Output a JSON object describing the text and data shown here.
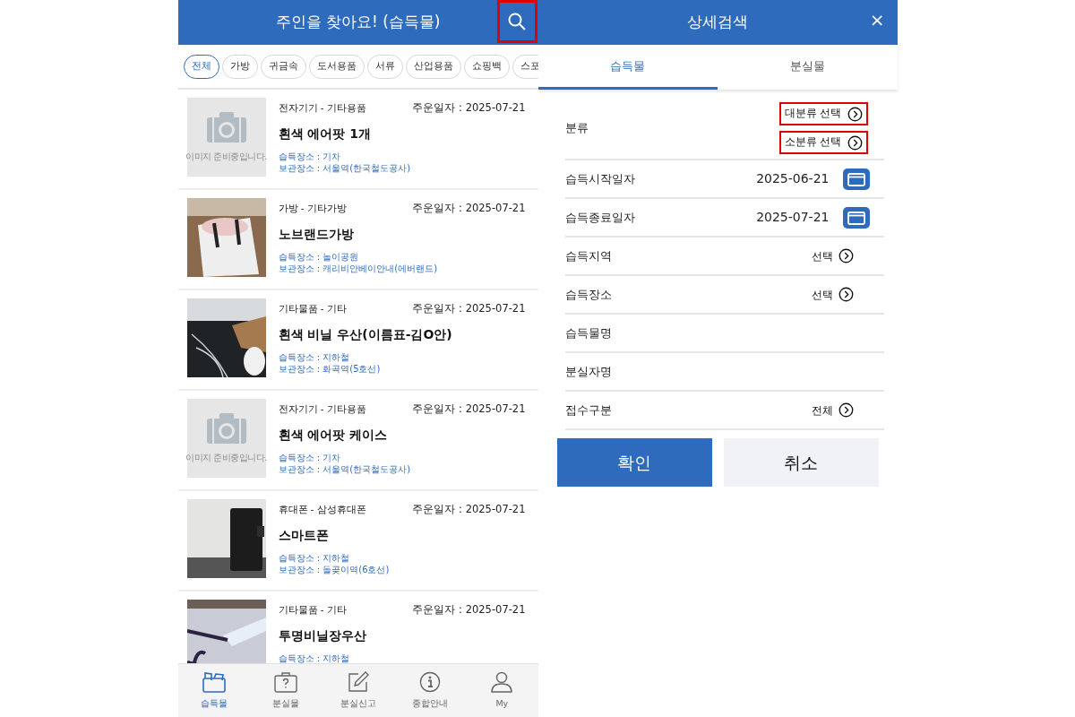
{
  "list_panel": {
    "title": "주인을 찾아요! (습득물)",
    "search_highlighted": true,
    "chips": [
      {
        "label": "전체",
        "selected": true
      },
      {
        "label": "가방",
        "selected": false
      },
      {
        "label": "귀금속",
        "selected": false
      },
      {
        "label": "도서용품",
        "selected": false
      },
      {
        "label": "서류",
        "selected": false
      },
      {
        "label": "산업용품",
        "selected": false
      },
      {
        "label": "쇼핑백",
        "selected": false
      },
      {
        "label": "스포",
        "selected": false
      }
    ],
    "items": [
      {
        "image": {
          "kind": "placeholder",
          "text": "이미지 준비중입니다."
        },
        "category": "전자기기 - 기타용품",
        "date": "주운일자 : 2025-07-21",
        "name": "흰색 에어팟 1개",
        "found_place": "습득장소 : 기차",
        "storage": "보관장소 : 서울역(한국철도공사)"
      },
      {
        "category": "가방 - 기타가방",
        "date": "주운일자 : 2025-07-21",
        "name": "노브랜드가방",
        "found_place": "습득장소 : 놀이공원",
        "storage": "보관장소 : 캐리비안베이안내(에버랜드)"
      },
      {
        "category": "기타물품 - 기타",
        "date": "주운일자 : 2025-07-21",
        "name": "흰색 비닐 우산(이름표-김O안)",
        "found_place": "습득장소 : 지하철",
        "storage": "보관장소 : 화곡역(5호선)"
      },
      {
        "image": {
          "kind": "placeholder",
          "text": "이미지 준비중입니다."
        },
        "category": "전자기기 - 기타용품",
        "date": "주운일자 : 2025-07-21",
        "name": "흰색 에어팟 케이스",
        "found_place": "습득장소 : 기차",
        "storage": "보관장소 : 서울역(한국철도공사)"
      },
      {
        "category": "휴대폰 - 삼성휴대폰",
        "date": "주운일자 : 2025-07-21",
        "name": "스마트폰",
        "found_place": "습득장소 : 지하철",
        "storage": "보관장소 : 돌곶이역(6호선)"
      },
      {
        "category": "기타물품 - 기타",
        "date": "주운일자 : 2025-07-21",
        "name": "투명비닐장우산",
        "found_place": "습득장소 : 지하철"
      }
    ],
    "tab_bar": [
      {
        "label": "습득물",
        "selected": true
      },
      {
        "label": "분실물",
        "selected": false
      },
      {
        "label": "분실신고",
        "selected": false
      },
      {
        "label": "종합안내",
        "selected": false
      },
      {
        "label": "My",
        "selected": false
      }
    ]
  },
  "search_panel": {
    "title": "상세검색",
    "close": "×",
    "tabs": [
      {
        "label": "습득물",
        "selected": true
      },
      {
        "label": "분실물",
        "selected": false
      }
    ],
    "rows": [
      {
        "kind": "category",
        "label": "분류",
        "options": [
          {
            "text": "대분류 선택",
            "highlighted": true
          },
          {
            "text": "소분류 선택",
            "highlighted": true
          }
        ]
      },
      {
        "kind": "date",
        "label": "습득시작일자",
        "value": "2025-06-21"
      },
      {
        "kind": "date",
        "label": "습득종료일자",
        "value": "2025-07-21"
      },
      {
        "kind": "select",
        "label": "습득지역",
        "value": "선택"
      },
      {
        "kind": "select",
        "label": "습득장소",
        "value": "선택"
      },
      {
        "kind": "text",
        "label": "습득물명"
      },
      {
        "kind": "text",
        "label": "분실자명"
      },
      {
        "kind": "select",
        "label": "접수구분",
        "value": "전체"
      }
    ],
    "buttons": [
      {
        "label": "확인",
        "kind": "primary"
      },
      {
        "label": "취소",
        "kind": "secondary"
      }
    ]
  }
}
